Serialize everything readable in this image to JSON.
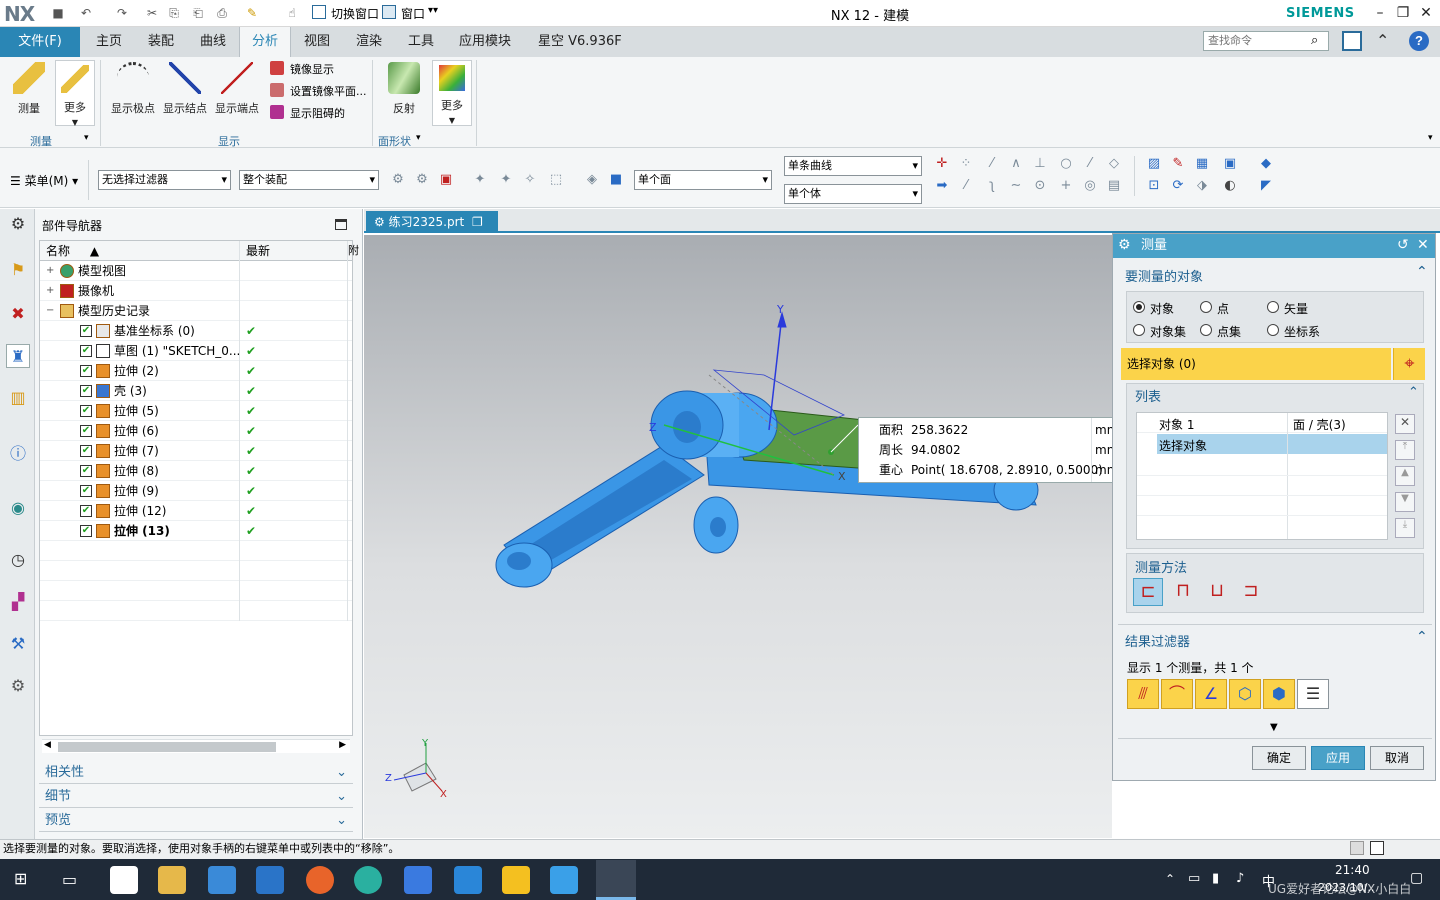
{
  "title_bar": {
    "logo": "NX",
    "switch_window": "切换窗口",
    "window_menu": "窗口",
    "title": "NX 12 - 建模",
    "brand": "SIEMENS"
  },
  "menu": {
    "file": "文件(F)",
    "tabs": [
      "主页",
      "装配",
      "曲线",
      "分析",
      "视图",
      "渲染",
      "工具",
      "应用模块",
      "星空 V6.936F"
    ],
    "active_tab": "分析",
    "search_placeholder": "查找命令"
  },
  "ribbon": {
    "measure": "测量",
    "more1": "更多",
    "group_measure": "测量",
    "show_poles": "显示极点",
    "show_knots": "显示结点",
    "show_endpoints": "显示端点",
    "mirror_display": "镜像显示",
    "set_mirror_plane": "设置镜像平面...",
    "show_blocking": "显示阻碍的",
    "group_display": "显示",
    "reflection": "反射",
    "more2": "更多",
    "group_shape": "面形状"
  },
  "toolbar": {
    "menu_btn": "菜单(M)",
    "filter": "无选择过滤器",
    "assembly": "整个装配",
    "face_mode": "单个面",
    "curve_mode": "单条曲线",
    "body_mode": "单个体"
  },
  "navigator": {
    "title": "部件导航器",
    "col_name": "名称",
    "col_latest": "最新",
    "col_extra": "附",
    "rows": [
      {
        "label": "模型视图",
        "latest": ""
      },
      {
        "label": "摄像机",
        "latest": ""
      },
      {
        "label": "模型历史记录",
        "latest": ""
      },
      {
        "label": "基准坐标系 (0)",
        "latest": "✔"
      },
      {
        "label": "草图 (1) \"SKETCH_0...",
        "latest": "✔"
      },
      {
        "label": "拉伸 (2)",
        "latest": "✔"
      },
      {
        "label": "壳 (3)",
        "latest": "✔"
      },
      {
        "label": "拉伸 (5)",
        "latest": "✔"
      },
      {
        "label": "拉伸 (6)",
        "latest": "✔"
      },
      {
        "label": "拉伸 (7)",
        "latest": "✔"
      },
      {
        "label": "拉伸 (8)",
        "latest": "✔"
      },
      {
        "label": "拉伸 (9)",
        "latest": "✔"
      },
      {
        "label": "拉伸 (12)",
        "latest": "✔"
      },
      {
        "label": "拉伸 (13)",
        "latest": "✔"
      }
    ],
    "sections": [
      "相关性",
      "细节",
      "预览"
    ]
  },
  "document": {
    "tab": "练习2325.prt"
  },
  "measure_tip": {
    "area_label": "面积",
    "area_value": "258.3622",
    "area_unit": "mn",
    "perimeter_label": "周长",
    "perimeter_value": "94.0802",
    "perimeter_unit": "mn",
    "centroid_label": "重心",
    "centroid_value": "Point( 18.6708, 2.8910, 0.5000)",
    "centroid_unit": "mn"
  },
  "axes": {
    "x": "X",
    "y": "Y",
    "z": "Z"
  },
  "dialog": {
    "title": "测量",
    "section_objects": "要测量的对象",
    "radio_object": "对象",
    "radio_point": "点",
    "radio_vector": "矢量",
    "radio_object_set": "对象集",
    "radio_point_set": "点集",
    "radio_csys": "坐标系",
    "select_object": "选择对象 (0)",
    "list_title": "列表",
    "list_item": "对象 1",
    "list_item_type": "面 / 壳(3)",
    "list_select": "选择对象",
    "method_title": "测量方法",
    "filter_title": "结果过滤器",
    "filter_summary": "显示 1 个测量，共 1 个",
    "ok": "确定",
    "apply": "应用",
    "cancel": "取消"
  },
  "status": "选择要测量的对象。要取消选择，使用对象手柄的右键菜单中或列表中的“移除”。",
  "taskbar": {
    "ime": "中",
    "time": "21:40",
    "date": "2023/10/..",
    "watermark": "UG爱好者论坛@NX小白白"
  }
}
